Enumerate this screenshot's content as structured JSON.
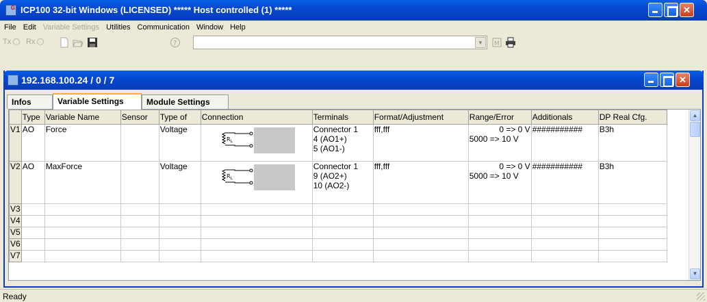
{
  "app": {
    "title": "ICP100 32-bit Windows  (LICENSED)  *****  Host controlled (1)  *****"
  },
  "menu": [
    "File",
    "Edit",
    "Variable Settings",
    "Utilities",
    "Communication",
    "Window",
    "Help"
  ],
  "menu_disabled": [
    false,
    false,
    true,
    false,
    false,
    false,
    false
  ],
  "toolbar": {
    "tx_label": "Tx",
    "rx_label": "Rx",
    "icons": [
      "new-file-icon",
      "open-folder-icon",
      "save-icon",
      "help-icon",
      "dropdown-arrow-icon",
      "module-icon",
      "print-icon"
    ]
  },
  "child": {
    "title": "192.168.100.24  / 0 / 7"
  },
  "tabs": [
    "Infos",
    "Variable Settings",
    "Module Settings"
  ],
  "active_tab": "Variable Settings",
  "grid": {
    "columns": [
      "",
      "Type",
      "Variable Name",
      "Sensor",
      "Type of",
      "Connection",
      "Terminals",
      "Format/Adjustment",
      "Range/Error",
      "Additionals",
      "DP Real Cfg."
    ],
    "rows": [
      {
        "id": "V1",
        "type": "AO",
        "name": "Force",
        "sensor": "",
        "type_of": "Voltage",
        "terminals": [
          "Connector 1",
          "4 (AO1+)",
          "5 (AO1-)"
        ],
        "format": "fff,fff",
        "range": [
          "0 => 0 V",
          "5000 => 10 V"
        ],
        "additionals": "###########",
        "dp": "B3h"
      },
      {
        "id": "V2",
        "type": "AO",
        "name": "MaxForce",
        "sensor": "",
        "type_of": "Voltage",
        "terminals": [
          "Connector 1",
          "9 (AO2+)",
          "10 (AO2-)"
        ],
        "format": "fff,fff",
        "range": [
          "0 => 0 V",
          "5000 => 10 V"
        ],
        "additionals": "###########",
        "dp": "B3h"
      }
    ],
    "empty_rows": [
      "V3",
      "V4",
      "V5",
      "V6",
      "V7"
    ],
    "resistor_label": "RL"
  },
  "status": {
    "text": "Ready"
  },
  "colors": {
    "title_blue": "#0448d0",
    "close_red": "#c8401c",
    "tab_highlight": "#f8b030"
  }
}
